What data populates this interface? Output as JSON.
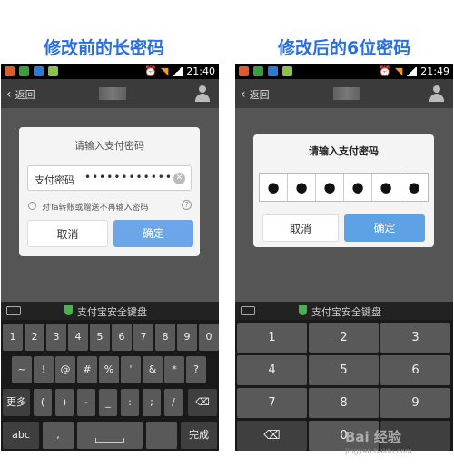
{
  "captions": {
    "left": "修改前的长密码",
    "right": "修改后的6位密码"
  },
  "left_phone": {
    "status_time": "21:40",
    "nav_back": "返回",
    "dialog_title": "请输入支付密码",
    "pwd_label": "支付密码",
    "pwd_value": "••••••••••••",
    "option_text": "对Ta转账或赠送不再输入密码",
    "cancel": "取消",
    "confirm": "确定",
    "keyboard_title": "支付宝安全键盘",
    "key_rows": [
      [
        "1",
        "2",
        "3",
        "4",
        "5",
        "6",
        "7",
        "8",
        "9",
        "0"
      ],
      [
        "~",
        "!",
        "@",
        "#",
        "%",
        "'",
        "&",
        "*",
        "?"
      ],
      [
        "更多",
        "(",
        ")",
        "-",
        "_",
        ":",
        ";",
        "/",
        "⌫"
      ],
      [
        "abc",
        ",",
        "",
        "",
        "",
        "",
        "",
        "完成"
      ]
    ]
  },
  "right_phone": {
    "status_time": "21:49",
    "nav_back": "返回",
    "dialog_title": "请输入支付密码",
    "pin_dots": [
      "●",
      "●",
      "●",
      "●",
      "●",
      "●"
    ],
    "cancel": "取消",
    "confirm": "确定",
    "keyboard_title": "支付宝安全键盘",
    "numpad": [
      "1",
      "2",
      "3",
      "4",
      "5",
      "6",
      "7",
      "8",
      "9",
      "⌫",
      "0",
      ""
    ]
  },
  "watermark": {
    "text": "Bai 经验",
    "url": "jingyan.baidu.com"
  }
}
